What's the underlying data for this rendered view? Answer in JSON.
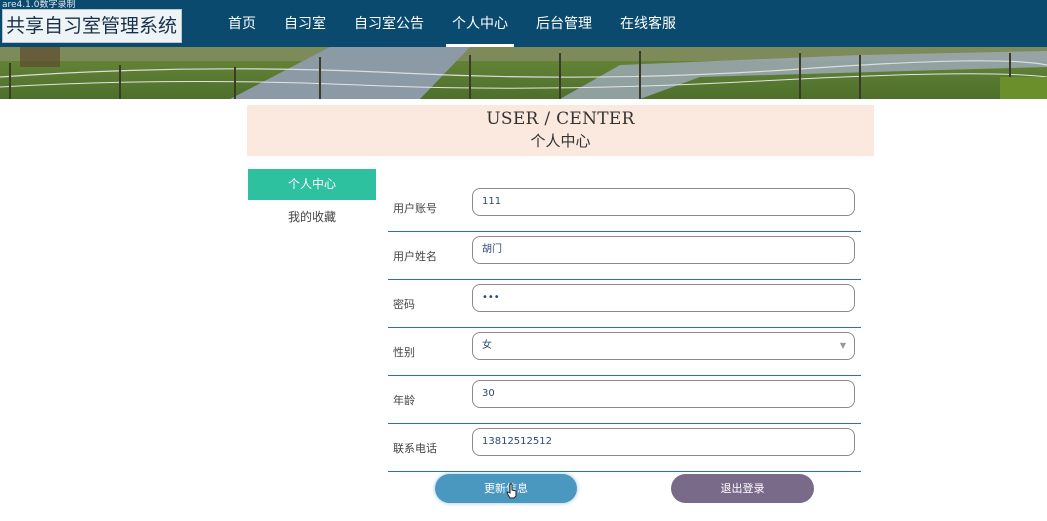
{
  "overlay_text": "are4.1.0数字录制",
  "app_title": "共享自习室管理系统",
  "nav": {
    "items": [
      {
        "label": "首页"
      },
      {
        "label": "自习室"
      },
      {
        "label": "自习室公告"
      },
      {
        "label": "个人中心"
      },
      {
        "label": "后台管理"
      },
      {
        "label": "在线客服"
      }
    ],
    "active": "个人中心"
  },
  "header": {
    "title_en": "USER / CENTER",
    "title_cn": "个人中心"
  },
  "sidebar": {
    "items": [
      {
        "label": "个人中心",
        "active": true
      },
      {
        "label": "我的收藏",
        "active": false
      }
    ]
  },
  "form": {
    "fields": [
      {
        "label": "用户账号",
        "value": "111"
      },
      {
        "label": "用户姓名",
        "value": "胡门"
      },
      {
        "label": "密码",
        "value": "•••"
      },
      {
        "label": "性别",
        "value": "女"
      },
      {
        "label": "年龄",
        "value": "30"
      },
      {
        "label": "联系电话",
        "value": "13812512512"
      }
    ],
    "update_label": "更新信息",
    "logout_label": "退出登录"
  },
  "colors": {
    "topbar": "#0a4a6e",
    "header_bg": "#fbe9e0",
    "side_active": "#2ec1a0",
    "update_button": "#4a98bf",
    "logout_button": "#7a6a8a",
    "row_border": "#2b7a8a"
  }
}
